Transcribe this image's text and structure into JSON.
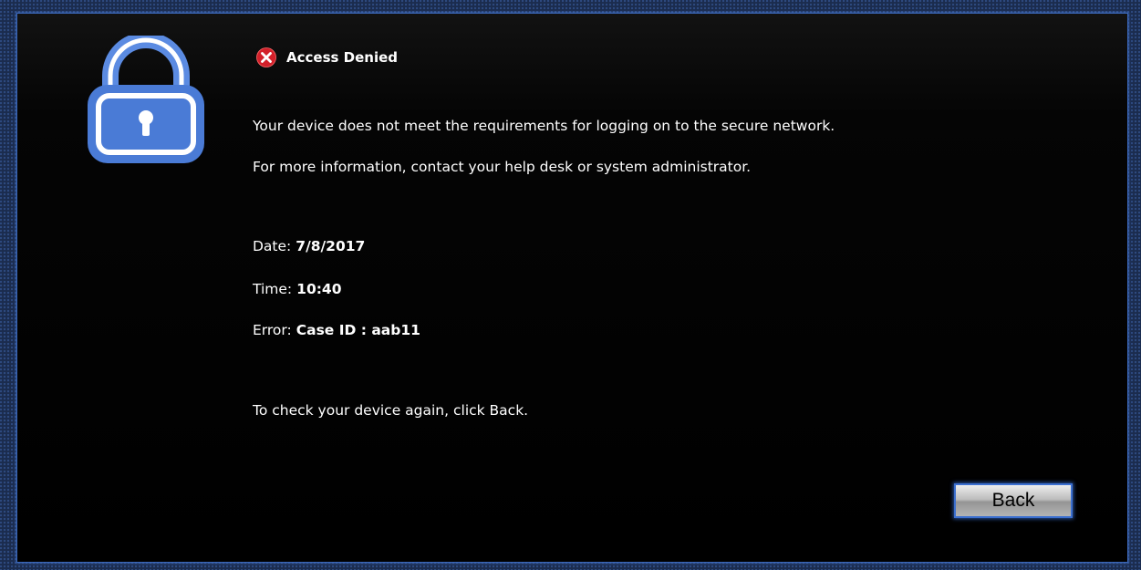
{
  "dialog": {
    "title": "Access Denied",
    "message_line_1": "Your device does not meet the requirements for logging on to the secure network.",
    "message_line_2": "For more information, contact your help desk or system administrator.",
    "details": {
      "date_label": "Date:",
      "date_value": "7/8/2017",
      "time_label": "Time:",
      "time_value": "10:40",
      "error_label": "Error:",
      "error_value": "Case ID : aab11"
    },
    "instruction": "To check your device again, click Back.",
    "back_label": "Back"
  },
  "icons": {
    "lock": "lock-icon",
    "error": "error-icon"
  },
  "colors": {
    "background": "#000000",
    "text": "#ffffff",
    "accent_blue": "#3b6fd0",
    "lock_blue": "#4c7fd9",
    "error_red": "#d3202a"
  }
}
